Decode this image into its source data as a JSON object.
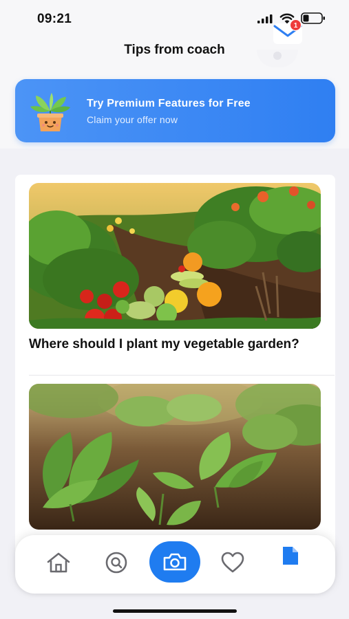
{
  "status_bar": {
    "time": "09:21",
    "signal_icon": "cellular-signal-icon",
    "wifi_icon": "wifi-icon",
    "battery_icon": "battery-icon",
    "battery_level": 0.25
  },
  "header": {
    "title": "Tips from coach"
  },
  "promo_banner": {
    "title": "Try Premium Features for Free",
    "subtitle": "Claim your offer now",
    "plant_icon": "potted-plant-icon",
    "mail_icon": "mail-icon",
    "badge_count": "1",
    "colors": {
      "background": "#2f7ff2",
      "badge": "#ee3b3b"
    }
  },
  "articles": [
    {
      "title": "Where should I plant my vegetable garden?",
      "image": "vegetable-garden-photo"
    },
    {
      "title": "",
      "image": "leafy-seedlings-photo"
    }
  ],
  "tab_bar": {
    "items": [
      {
        "name": "home",
        "icon": "home-icon"
      },
      {
        "name": "search",
        "icon": "search-icon"
      },
      {
        "name": "camera",
        "icon": "camera-icon",
        "active": true
      },
      {
        "name": "favorites",
        "icon": "heart-icon"
      },
      {
        "name": "notes",
        "icon": "notes-icon"
      }
    ],
    "colors": {
      "accent": "#1f7cf0"
    }
  }
}
